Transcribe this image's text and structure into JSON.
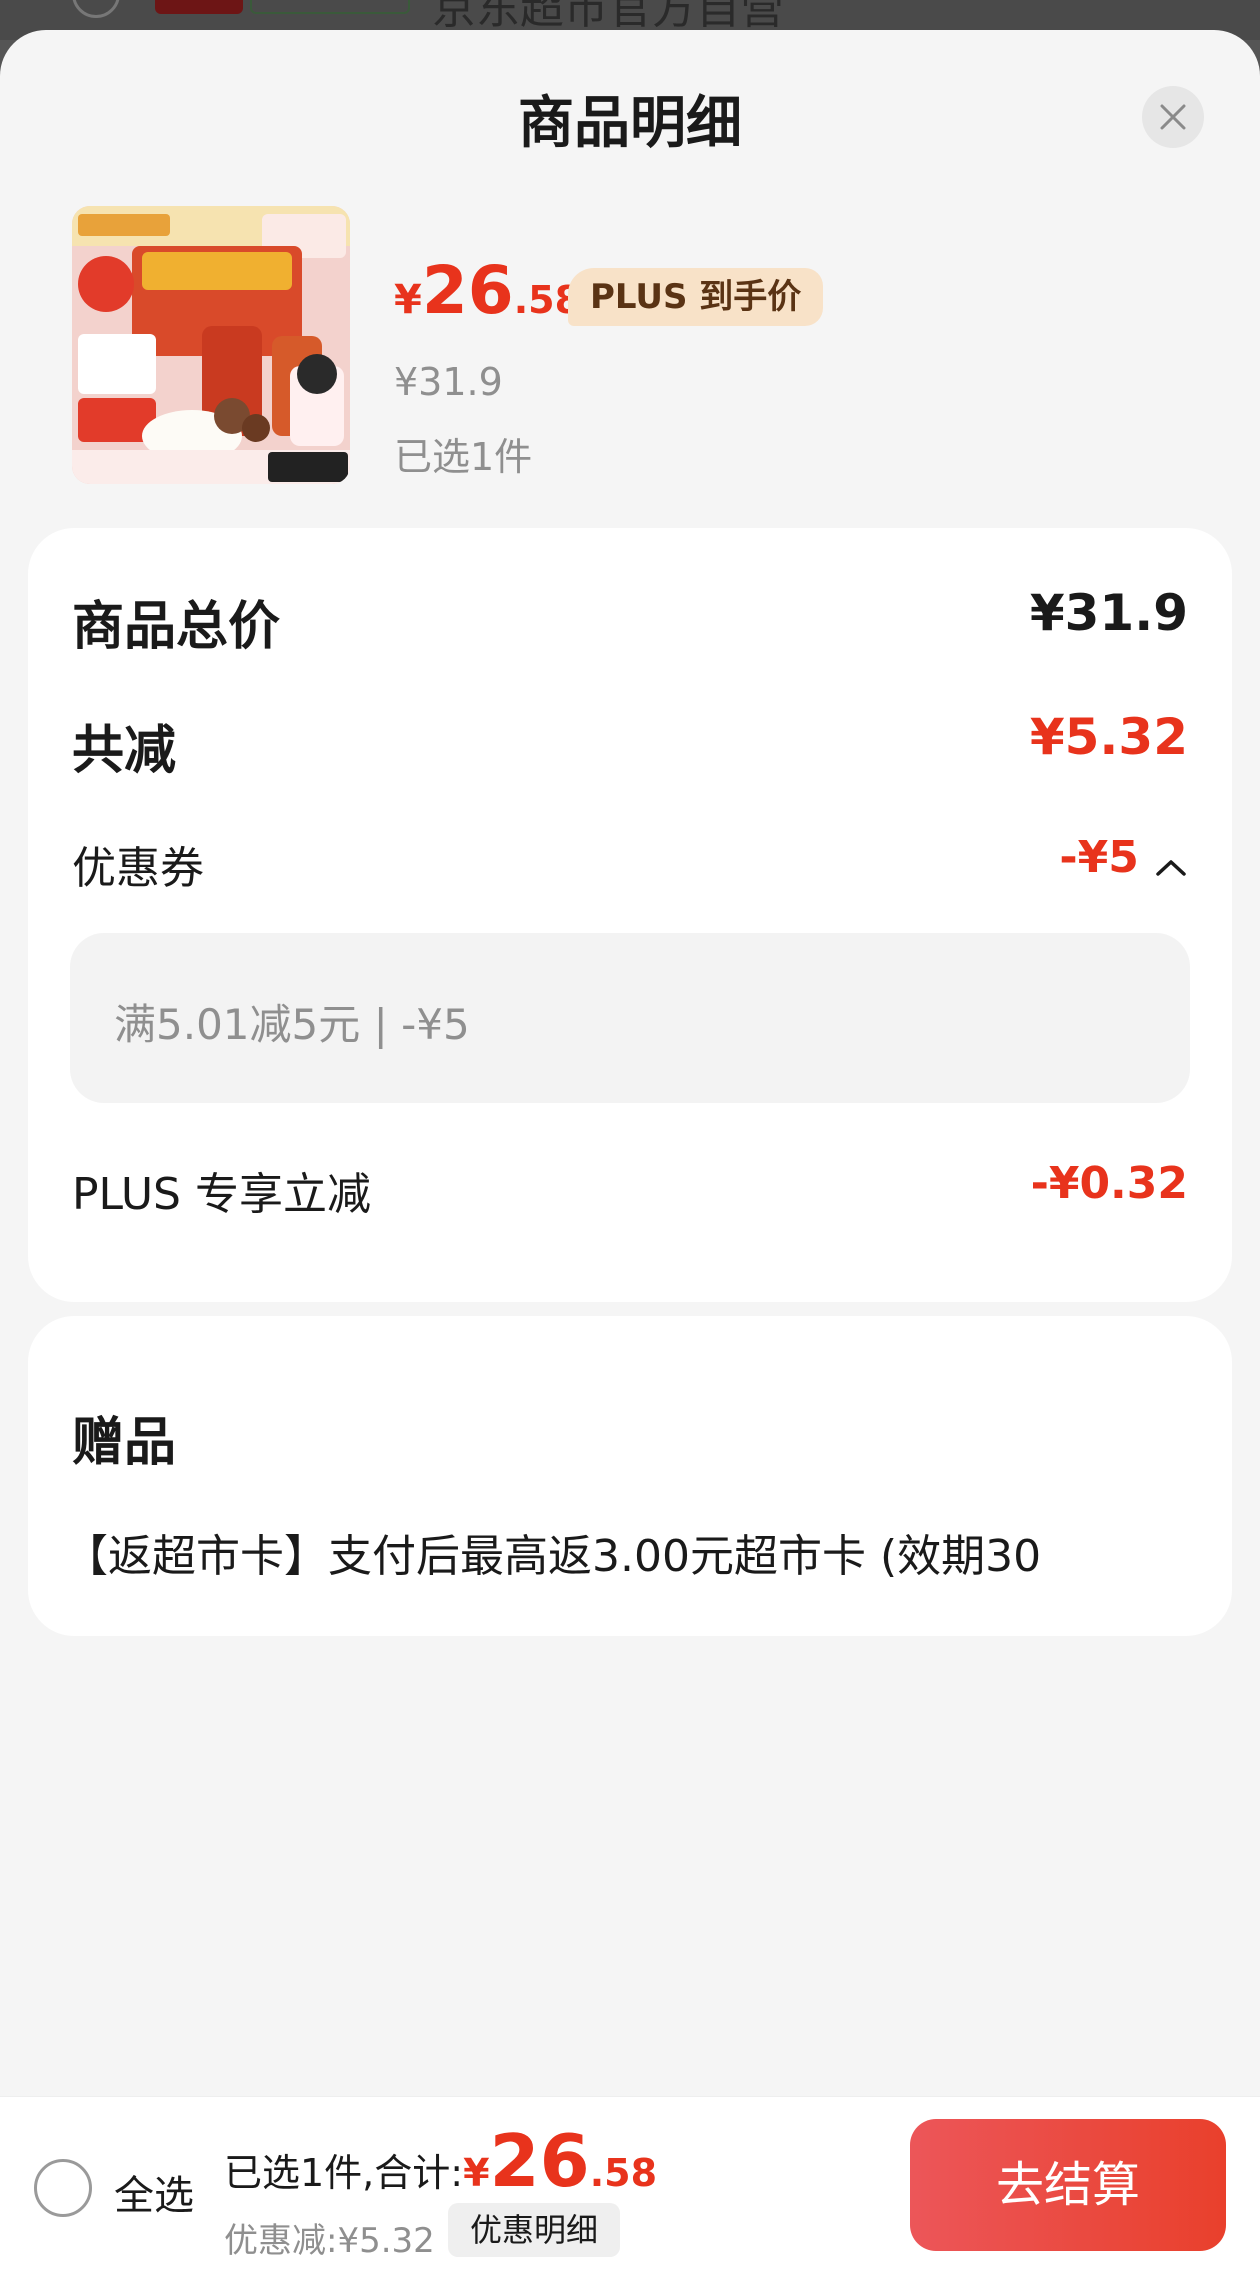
{
  "underlay": {
    "store_text": "京东超市官方自营"
  },
  "sheet": {
    "title": "商品明细"
  },
  "product": {
    "price_symbol": "¥",
    "price_int": "26",
    "price_dec": ".58",
    "plus_tag": "PLUS 到手价",
    "original_price": "¥31.9",
    "selected": "已选1件"
  },
  "breakdown": {
    "total_label": "商品总价",
    "total_value": "¥31.9",
    "reduce_label": "共减",
    "reduce_value": "¥5.32",
    "coupon_label": "优惠券",
    "coupon_value": "-¥5",
    "coupon_detail": "满5.01减5元 | -¥5",
    "plus_label": "PLUS 专享立减",
    "plus_value": "-¥0.32"
  },
  "gift": {
    "title": "赠品",
    "text": "【返超市卡】支付后最高返3.00元超市卡 (效期30"
  },
  "bottom": {
    "select_all": "全选",
    "summary_text": "已选1件,合计:",
    "yen": "¥",
    "total_int": "26",
    "total_dec": ".58",
    "discount": "优惠减:¥5.32",
    "detail_button": "优惠明细",
    "checkout_button": "去结算"
  },
  "colors": {
    "accent_red": "#e8331c",
    "plus_gold_bg": "#f8e2c8"
  },
  "icons": {
    "close": "close-icon",
    "collapse": "chevron-up-icon",
    "radio": "radio-unchecked-icon"
  }
}
